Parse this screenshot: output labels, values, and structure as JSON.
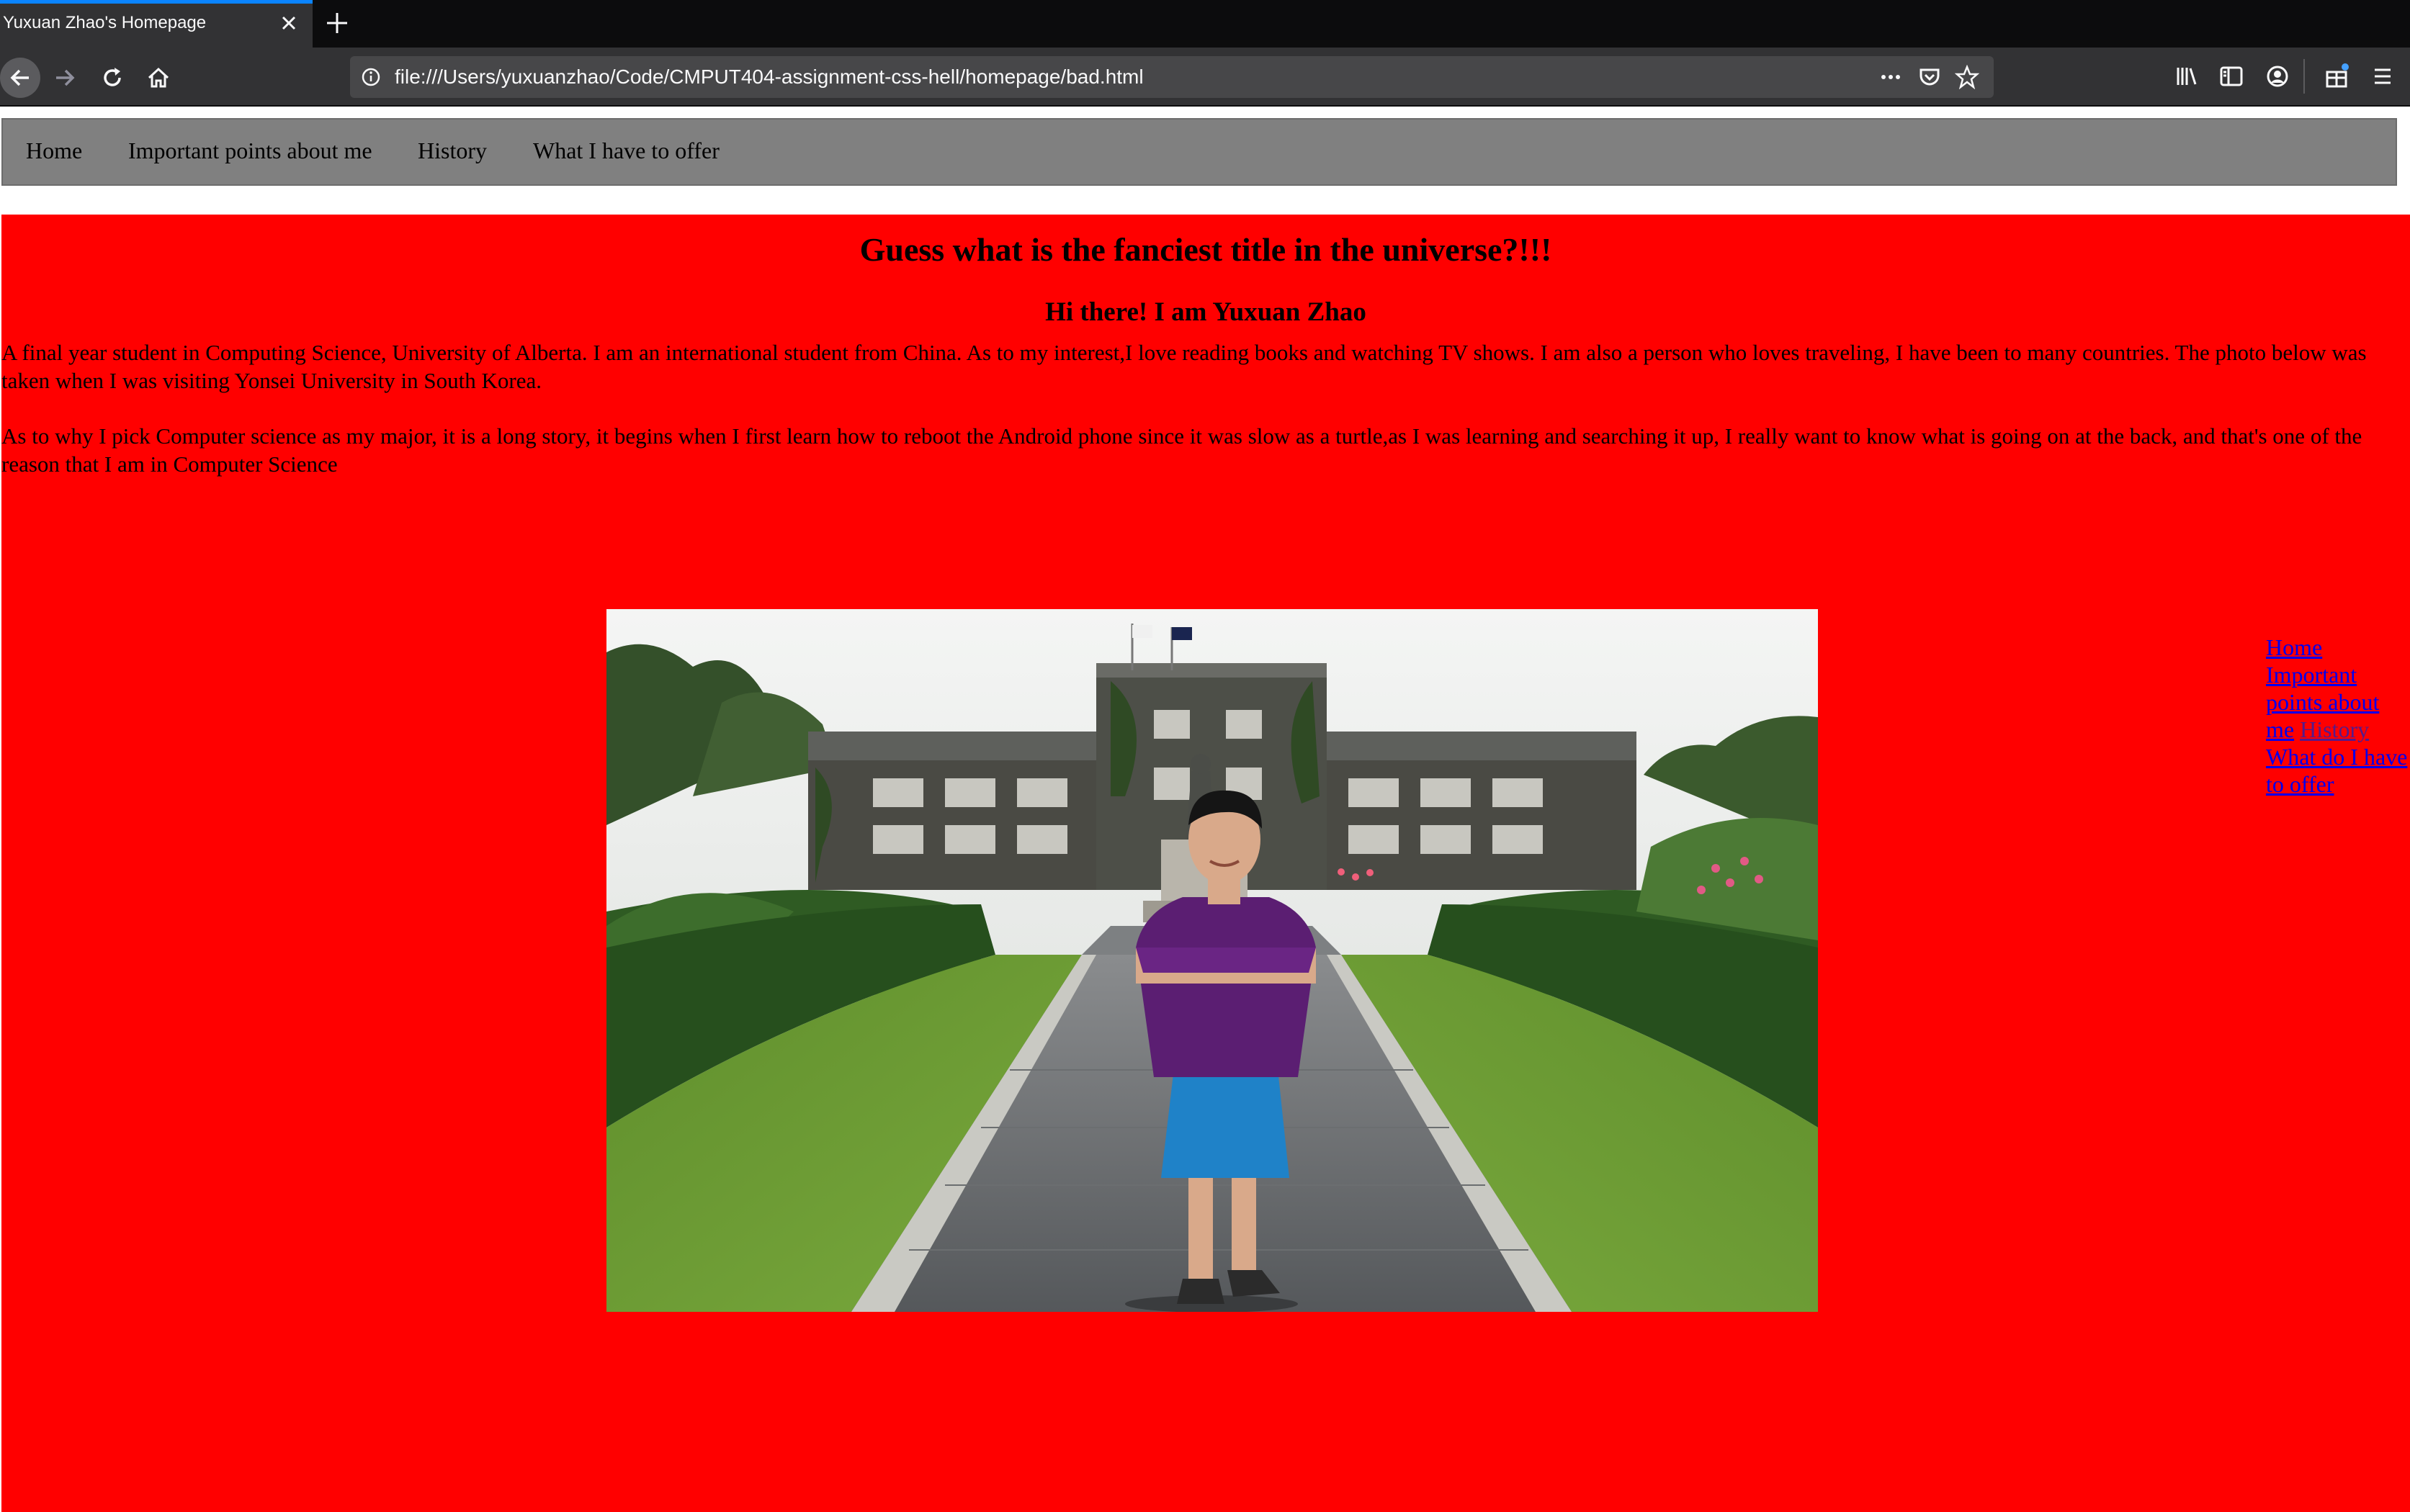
{
  "browser": {
    "tab_title": "Yuxuan Zhao's Homepage",
    "url": "file:///Users/yuxuanzhao/Code/CMPUT404-assignment-css-hell/homepage/bad.html",
    "icons": [
      "close-icon",
      "plus-icon",
      "back-arrow-icon",
      "forward-arrow-icon",
      "reload-icon",
      "home-icon",
      "info-icon",
      "more-dots-icon",
      "pocket-icon",
      "star-icon",
      "library-icon",
      "sidebar-icon",
      "account-icon",
      "extensions-icon",
      "hamburger-menu-icon"
    ]
  },
  "page": {
    "nav": [
      "Home",
      "Important points about me",
      "History",
      "What I have to offer"
    ],
    "title": "Guess what is the fanciest title in the universe?!!!",
    "subtitle": "Hi there! I am Yuxuan Zhao",
    "paragraph1": "A final year student in Computing Science, University of Alberta. I am an international student from China. As to my interest,I love reading books and watching TV shows. I am also a person who loves traveling, I have been to many countries. The photo below was taken when I was visiting Yonsei University in South Korea.",
    "paragraph2": "As to why I pick Computer science as my major, it is a long story, it begins when I first learn how to reboot the Android phone since it was slow as a turtle,as I was learning and searching it up,   I really want to know what is going on at the back, and that's one of the reason that I am in Computer Science",
    "side_links": [
      "Home",
      "Important points about me",
      "History",
      "What do I have to offer"
    ],
    "photo_subject": "student-at-yonsei-university-photo",
    "colors": {
      "background": "#ff0000",
      "nav_bar": "#808080",
      "link": "#0000ee",
      "visited_link": "#551a8b",
      "tab_accent": "#0a84ff"
    }
  }
}
